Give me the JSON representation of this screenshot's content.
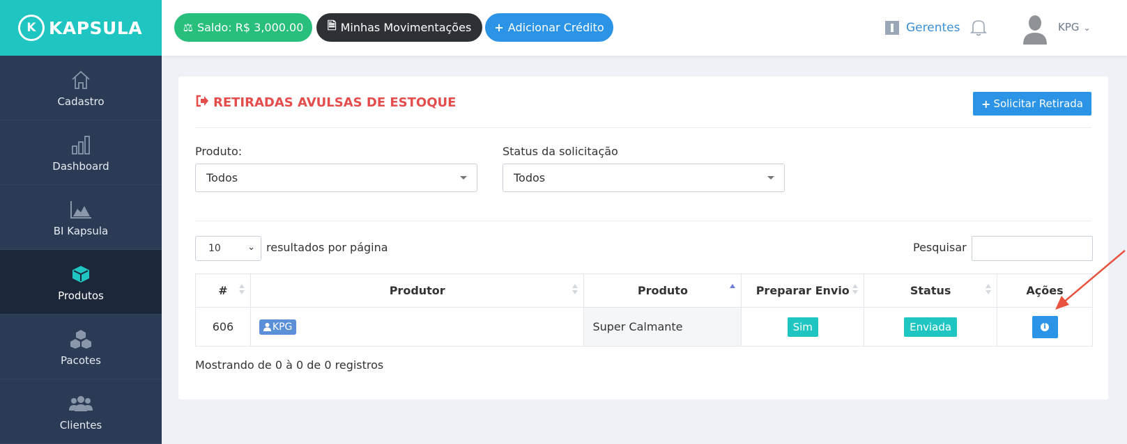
{
  "brand": {
    "logo_letter": "K",
    "name": "KAPSULA"
  },
  "sidebar": {
    "items": [
      {
        "label": "Cadastro",
        "icon": "home-icon",
        "active": false
      },
      {
        "label": "Dashboard",
        "icon": "bar-chart-icon",
        "active": false
      },
      {
        "label": "BI Kapsula",
        "icon": "area-chart-icon",
        "active": false
      },
      {
        "label": "Produtos",
        "icon": "cube-icon",
        "active": true
      },
      {
        "label": "Pacotes",
        "icon": "cubes-icon",
        "active": false
      },
      {
        "label": "Clientes",
        "icon": "users-icon",
        "active": false
      }
    ]
  },
  "header": {
    "saldo": "Saldo: R$ 3,000.00",
    "movimentacoes": "Minhas Movimentações",
    "adicionar": "Adicionar Crédito",
    "gerentes": "Gerentes",
    "user": "KPG"
  },
  "card": {
    "title": "RETIRADAS AVULSAS DE ESTOQUE",
    "solicitar_button": "Solicitar Retirada",
    "filters": {
      "produto_label": "Produto:",
      "produto_value": "Todos",
      "status_label": "Status da solicitação",
      "status_value": "Todos"
    },
    "length": {
      "value": "10",
      "suffix": "resultados por página"
    },
    "search_label": "Pesquisar",
    "table": {
      "columns": [
        "#",
        "Produtor",
        "Produto",
        "Preparar Envio",
        "Status",
        "Ações"
      ],
      "rows": [
        {
          "id": "606",
          "produtor": "KPG",
          "produto": "Super Calmante",
          "preparar_envio": "Sim",
          "status": "Enviada"
        }
      ]
    },
    "info": "Mostrando de 0 à 0 de 0 registros"
  },
  "colors": {
    "teal": "#1fc5c1",
    "sidebar": "#2b3a55",
    "accent_red": "#e54d4d",
    "primary_blue": "#2b94e6",
    "green": "#27bf7b"
  }
}
